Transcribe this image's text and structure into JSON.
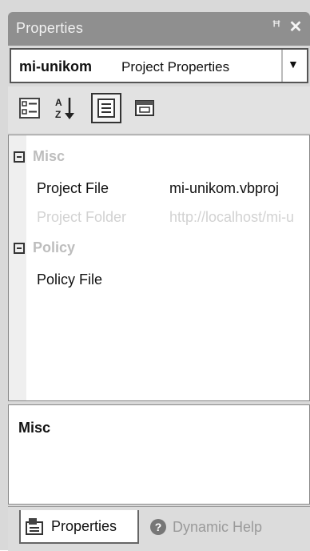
{
  "window": {
    "title": "Properties",
    "pin_icon": "pin-icon",
    "close_icon": "close-icon"
  },
  "object_selector": {
    "name": "mi-unikom",
    "type": "Project Properties",
    "arrow": "▼"
  },
  "toolbar": {
    "buttons": [
      "categorized-icon",
      "alphabetical-icon",
      "properties-icon",
      "property-pages-icon"
    ]
  },
  "grid": {
    "categories": [
      {
        "label": "Misc",
        "properties": [
          {
            "name": "Project File",
            "value": "mi-unikom.vbproj"
          },
          {
            "name": "Project Folder",
            "value": "http://localhost/mi-u"
          }
        ]
      },
      {
        "label": "Policy",
        "properties": [
          {
            "name": "Policy File",
            "value": ""
          }
        ]
      }
    ]
  },
  "description": {
    "title": "Misc"
  },
  "tabs": [
    {
      "label": "Properties",
      "icon": "properties-tab-icon"
    },
    {
      "label": "Dynamic Help",
      "icon": "help-icon"
    }
  ]
}
